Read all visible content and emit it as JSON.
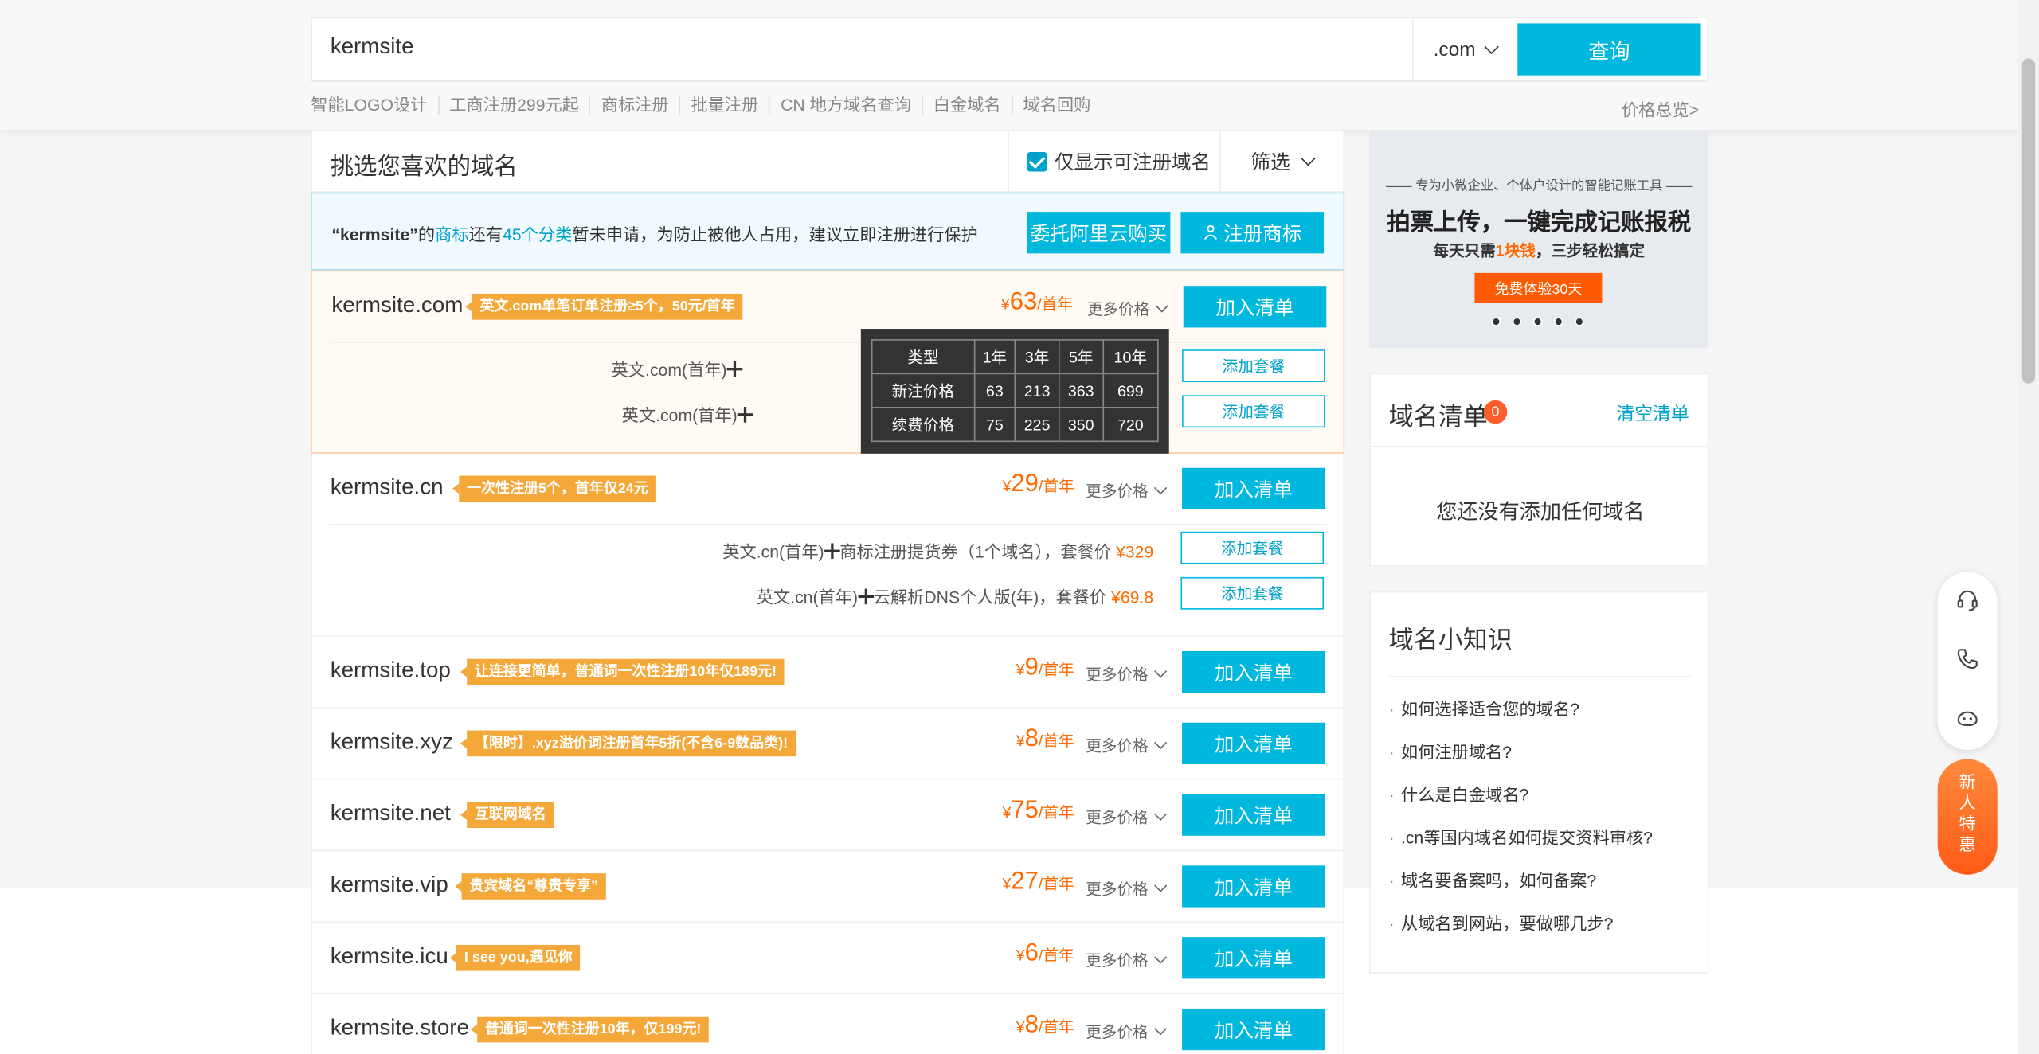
{
  "search": {
    "query": "kermsite",
    "tld": ".com",
    "button_label": "查询"
  },
  "quick_links": [
    "智能LOGO设计",
    "工商注册299元起",
    "商标注册",
    "批量注册",
    "CN 地方域名查询",
    "白金域名",
    "域名回购"
  ],
  "price_overview": "价格总览>",
  "list": {
    "title": "挑选您喜欢的域名",
    "only_available_label": "仅显示可注册域名",
    "filter_label": "筛选"
  },
  "trademark": {
    "keyword": "“kermsite”",
    "text_1": "的",
    "link_1": "商标",
    "text_2": "还有",
    "link_2": "45个分类",
    "text_3": "暂未申请，为防止被他人占用，建议立即注册进行保护",
    "entrust_label": "委托阿里云购买",
    "register_label": "注册商标"
  },
  "common": {
    "yen": "¥",
    "per_year": "/首年",
    "more_prices": "更多价格",
    "add_to_list": "加入清单",
    "add_package": "添加套餐"
  },
  "domains": [
    {
      "name": "kermsite.com",
      "tag": "英文.com单笔订单注册≥5个，50元/首年",
      "price": "63",
      "bundles": [
        {
          "text": "英文.com(首年)",
          "suffix": ""
        },
        {
          "text": "英文.com(首年)",
          "suffix": ""
        }
      ]
    },
    {
      "name": "kermsite.cn",
      "tag": "一次性注册5个，首年仅24元",
      "price": "29",
      "bundles": [
        {
          "text": "英文.cn(首年)",
          "suffix": "商标注册提货券（1个域名），套餐价",
          "price": "¥329"
        },
        {
          "text": "英文.cn(首年)",
          "suffix": "云解析DNS个人版(年)，套餐价",
          "price": "¥69.8"
        }
      ]
    },
    {
      "name": "kermsite.top",
      "tag": "让连接更简单，普通词一次性注册10年仅189元!",
      "price": "9"
    },
    {
      "name": "kermsite.xyz",
      "tag": "【限时】.xyz溢价词注册首年5折(不含6-9数品类)!",
      "price": "8"
    },
    {
      "name": "kermsite.net",
      "tag": "互联网域名",
      "price": "75"
    },
    {
      "name": "kermsite.vip",
      "tag": "贵宾域名“尊贵专享”",
      "price": "27"
    },
    {
      "name": "kermsite.icu",
      "tag": "I see you,遇见你",
      "price": "6"
    },
    {
      "name": "kermsite.store",
      "tag": "普通词一次性注册10年，仅199元!",
      "price": "8"
    }
  ],
  "price_table": {
    "headers": [
      "类型",
      "1年",
      "3年",
      "5年",
      "10年"
    ],
    "rows": [
      [
        "新注价格",
        "63",
        "213",
        "363",
        "699"
      ],
      [
        "续费价格",
        "75",
        "225",
        "350",
        "720"
      ]
    ]
  },
  "ad": {
    "subtitle": "专为小微企业、个体户设计的智能记账工具",
    "title": "拍票上传，一键完成记账报税",
    "line_pre": "每天只需",
    "line_hl": "1块钱",
    "line_post": "，三步轻松搞定",
    "cta": "免费体验30天"
  },
  "cart": {
    "title": "域名清单",
    "count": "0",
    "clear_label": "清空清单",
    "empty_text": "您还没有添加任何域名"
  },
  "tips": {
    "title": "域名小知识",
    "items": [
      "如何选择适合您的域名?",
      "如何注册域名?",
      "什么是白金域名?",
      ".cn等国内域名如何提交资料审核?",
      "域名要备案吗，如何备案?",
      "从域名到网站，要做哪几步?"
    ]
  },
  "newbie": [
    "新",
    "人",
    "特",
    "惠"
  ],
  "colors": {
    "accent": "#00b7dd",
    "price": "#ff6a00",
    "tag": "#f4a83a"
  }
}
